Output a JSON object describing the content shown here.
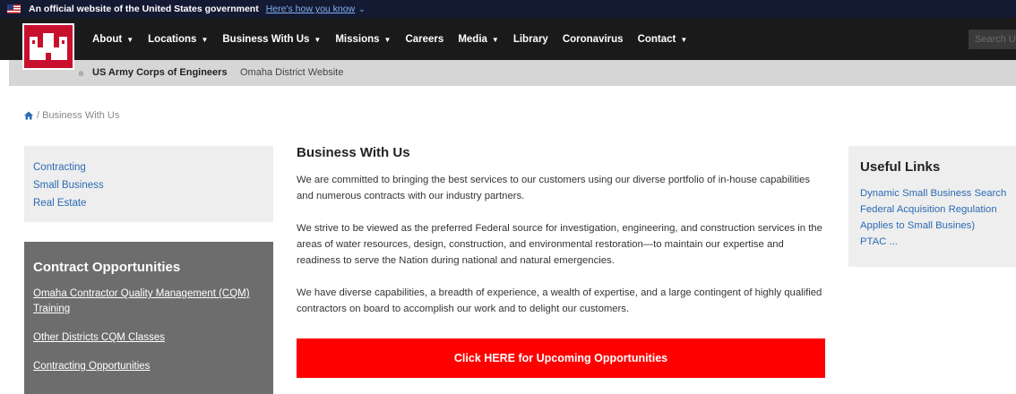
{
  "gov_banner": {
    "text": "An official website of the United States government",
    "link": "Here's how you know"
  },
  "nav": {
    "items": [
      {
        "label": "About",
        "dropdown": true
      },
      {
        "label": "Locations",
        "dropdown": true
      },
      {
        "label": "Business With Us",
        "dropdown": true
      },
      {
        "label": "Missions",
        "dropdown": true
      },
      {
        "label": "Careers",
        "dropdown": false
      },
      {
        "label": "Media",
        "dropdown": true
      },
      {
        "label": "Library",
        "dropdown": false
      },
      {
        "label": "Coronavirus",
        "dropdown": false
      },
      {
        "label": "Contact",
        "dropdown": true
      }
    ],
    "search_placeholder": "Search U"
  },
  "site_bar": {
    "reg": "®",
    "name": "US Army Corps of Engineers",
    "subtitle": "Omaha District Website"
  },
  "breadcrumb": {
    "separator": "/",
    "current": "Business With Us"
  },
  "left_links": [
    "Contracting",
    "Small Business",
    "Real Estate"
  ],
  "contract_box": {
    "title": "Contract Opportunities",
    "links": [
      "Omaha Contractor Quality Management (CQM) Training",
      "Other Districts CQM Classes",
      "Contracting Opportunities"
    ]
  },
  "main": {
    "title": "Business With Us",
    "paragraphs": [
      "We are committed to bringing the best services to our customers using our diverse portfolio of in-house capabilities and numerous contracts with our industry partners.",
      "We strive to be viewed as the preferred Federal source for investigation, engineering, and construction services in the areas of water resources, design, construction, and environmental restoration—to maintain our expertise and readiness to serve the Nation during national and natural emergencies.",
      "We have diverse capabilities, a breadth of experience, a wealth of expertise, and a large contingent of highly qualified contractors on board to accomplish our work and to delight our customers."
    ],
    "cta": "Click HERE for Upcoming Opportunities"
  },
  "useful_links": {
    "title": "Useful Links",
    "links": [
      "Dynamic Small Business Search",
      "Federal Acquisition Regulation",
      "Applies to Small Busines)",
      "PTAC ..."
    ]
  },
  "colors": {
    "gov_banner_bg": "#151a33",
    "nav_bg": "#1a1a1a",
    "logo_red": "#c8102e",
    "link_blue": "#2b6bb3",
    "cta_red": "#ff0000",
    "contract_box_bg": "#6d6d6d"
  }
}
